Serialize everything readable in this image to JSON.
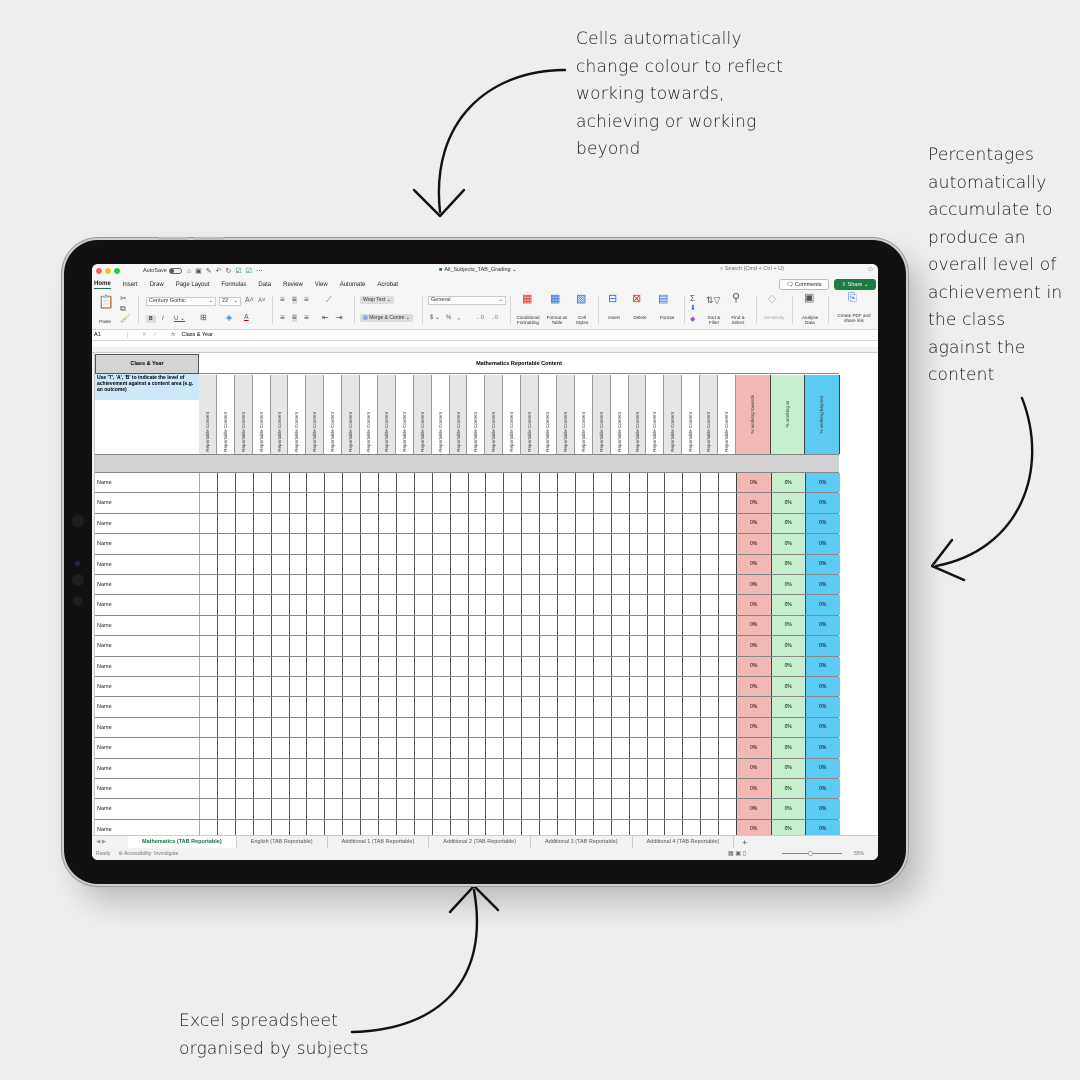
{
  "annotations": {
    "top": [
      "Cells automatically",
      "change colour to reflect",
      "working towards,",
      "achieving or working",
      "beyond"
    ],
    "right": [
      "Percentages",
      "automatically",
      "accumulate to",
      "produce an",
      "overall level of",
      "achievement in",
      "the class",
      "against the",
      "content"
    ],
    "bottom": [
      "Excel spreadsheet",
      "organised by subjects"
    ]
  },
  "titlebar": {
    "autosave_label": "AutoSave",
    "doc_title": "All_Subjects_TAB_Grading",
    "search_placeholder": "Search (Cmd + Ctrl + U)"
  },
  "ribbon_tabs": [
    "Home",
    "Insert",
    "Draw",
    "Page Layout",
    "Formulas",
    "Data",
    "Review",
    "View",
    "Automate",
    "Acrobat"
  ],
  "active_tab": "Home",
  "header_buttons": {
    "comments": "Comments",
    "share": "Share"
  },
  "ribbon": {
    "paste": "Paste",
    "font_name": "Century Gothic",
    "font_size": "22",
    "wrap_text": "Wrap Text",
    "merge_centre": "Merge & Centre",
    "number_format": "General",
    "conditional_formatting": "Conditional Formatting",
    "format_as_table": "Format as Table",
    "cell_styles": "Cell Styles",
    "insert": "Insert",
    "delete": "Delete",
    "format": "Format",
    "sort_filter": "Sort & Filter",
    "find_select": "Find & Select",
    "sensitivity": "Sensitivity",
    "analyse_data": "Analyse Data",
    "create_pdf": "Create PDF and share link"
  },
  "formula_bar": {
    "name_box": "A1",
    "fx": "fx",
    "content": "Class & Year"
  },
  "sheet": {
    "class_year": "Class & Year",
    "instruction": "Use 'T', 'A', 'B' to indicate the level of achievement against a content area (e.g. an outcome)",
    "subject_title": "Mathematics Reportable Content",
    "content_column_label": "Reportable Content",
    "content_column_count": 30,
    "pct_headers": [
      {
        "label": "% working towards",
        "color": "#f2b8b5"
      },
      {
        "label": "% working at",
        "color": "#c7efcf"
      },
      {
        "label": "% working beyond",
        "color": "#5ccbf3"
      }
    ],
    "rows": [
      {
        "name": "Name",
        "towards": "0%",
        "at": "0%",
        "beyond": "0%"
      },
      {
        "name": "Name",
        "towards": "0%",
        "at": "0%",
        "beyond": "0%"
      },
      {
        "name": "Name",
        "towards": "0%",
        "at": "0%",
        "beyond": "0%"
      },
      {
        "name": "Name",
        "towards": "0%",
        "at": "0%",
        "beyond": "0%"
      },
      {
        "name": "Name",
        "towards": "0%",
        "at": "0%",
        "beyond": "0%"
      },
      {
        "name": "Name",
        "towards": "0%",
        "at": "0%",
        "beyond": "0%"
      },
      {
        "name": "Name",
        "towards": "0%",
        "at": "0%",
        "beyond": "0%"
      },
      {
        "name": "Name",
        "towards": "0%",
        "at": "0%",
        "beyond": "0%"
      },
      {
        "name": "Name",
        "towards": "0%",
        "at": "0%",
        "beyond": "0%"
      },
      {
        "name": "Name",
        "towards": "0%",
        "at": "0%",
        "beyond": "0%"
      },
      {
        "name": "Name",
        "towards": "0%",
        "at": "0%",
        "beyond": "0%"
      },
      {
        "name": "Name",
        "towards": "0%",
        "at": "0%",
        "beyond": "0%"
      },
      {
        "name": "Name",
        "towards": "0%",
        "at": "0%",
        "beyond": "0%"
      },
      {
        "name": "Name",
        "towards": "0%",
        "at": "0%",
        "beyond": "0%"
      },
      {
        "name": "Name",
        "towards": "0%",
        "at": "0%",
        "beyond": "0%"
      },
      {
        "name": "Name",
        "towards": "0%",
        "at": "0%",
        "beyond": "0%"
      },
      {
        "name": "Name",
        "towards": "0%",
        "at": "0%",
        "beyond": "0%"
      },
      {
        "name": "Name",
        "towards": "0%",
        "at": "0%",
        "beyond": "0%"
      }
    ]
  },
  "sheet_tabs": [
    "Mathematics (TAB Reportable)",
    "English (TAB Reportable)",
    "Additional 1 (TAB Reportable)",
    "Additional 2 (TAB Reportable)",
    "Additional 3 (TAB Reportable)",
    "Additional 4 (TAB Reportable)"
  ],
  "active_sheet": "Mathematics (TAB Reportable)",
  "statusbar": {
    "status": "Ready",
    "accessibility": "Accessibility: Investigate",
    "zoom": "55%"
  }
}
